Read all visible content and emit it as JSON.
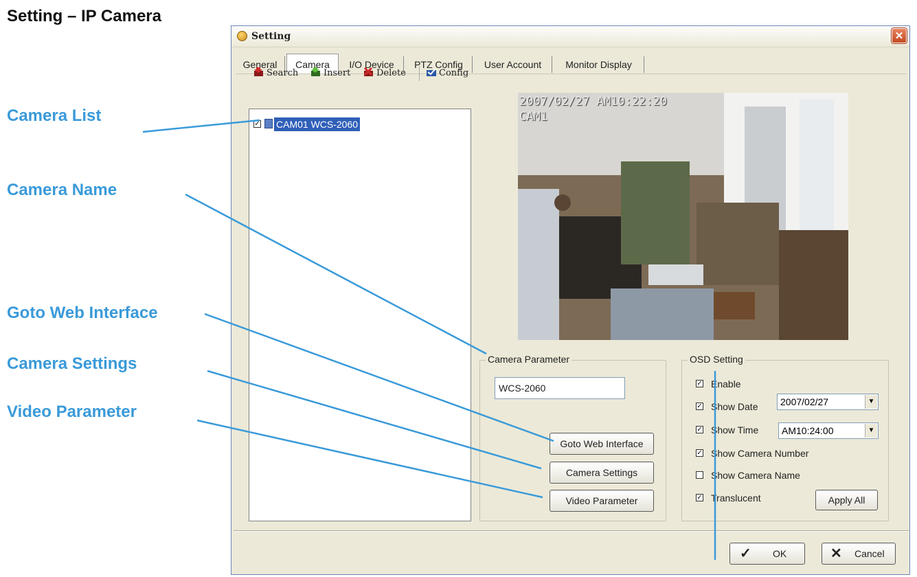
{
  "doc_title": "Setting – IP Camera",
  "annotations": {
    "camera_list": "Camera List",
    "camera_name": "Camera Name",
    "goto_web": "Goto Web Interface",
    "camera_settings": "Camera Settings",
    "video_parameter": "Video Parameter"
  },
  "window": {
    "title": "Setting",
    "close_glyph": "✕",
    "tabs": [
      "General",
      "Camera",
      "I/O Device",
      "PTZ Config",
      "User Account",
      "Monitor Display"
    ],
    "active_tab": "Camera"
  },
  "toolbar": {
    "search": "Search",
    "insert": "Insert",
    "delete": "Delete",
    "config": "Config"
  },
  "camera_list": {
    "items": [
      {
        "label": "CAM01 WCS-2060",
        "checked": true
      }
    ]
  },
  "video": {
    "overlay_line1": "2007/02/27 AM10:22:20",
    "overlay_line2": "CAM1"
  },
  "camera_parameter": {
    "group_label": "Camera Parameter",
    "name_value": "WCS-2060",
    "goto_web_button": "Goto Web Interface",
    "camera_settings_button": "Camera Settings",
    "video_parameter_button": "Video Parameter"
  },
  "osd": {
    "group_label": "OSD Setting",
    "enable": "Enable",
    "show_date": "Show Date",
    "date_value": "2007/02/27",
    "show_time": "Show Time",
    "time_value": "AM10:24:00",
    "show_camera_number": "Show Camera Number",
    "show_camera_name": "Show Camera Name",
    "translucent": "Translucent",
    "apply_all": "Apply All",
    "checks": {
      "enable": true,
      "show_date": true,
      "show_time": true,
      "show_camera_number": true,
      "show_camera_name": false,
      "translucent": true
    }
  },
  "footer": {
    "ok": "OK",
    "cancel": "Cancel"
  },
  "colors": {
    "annotation": "#3a9ad9",
    "window_bg": "#ece9d8",
    "selection": "#2f5fb8"
  }
}
